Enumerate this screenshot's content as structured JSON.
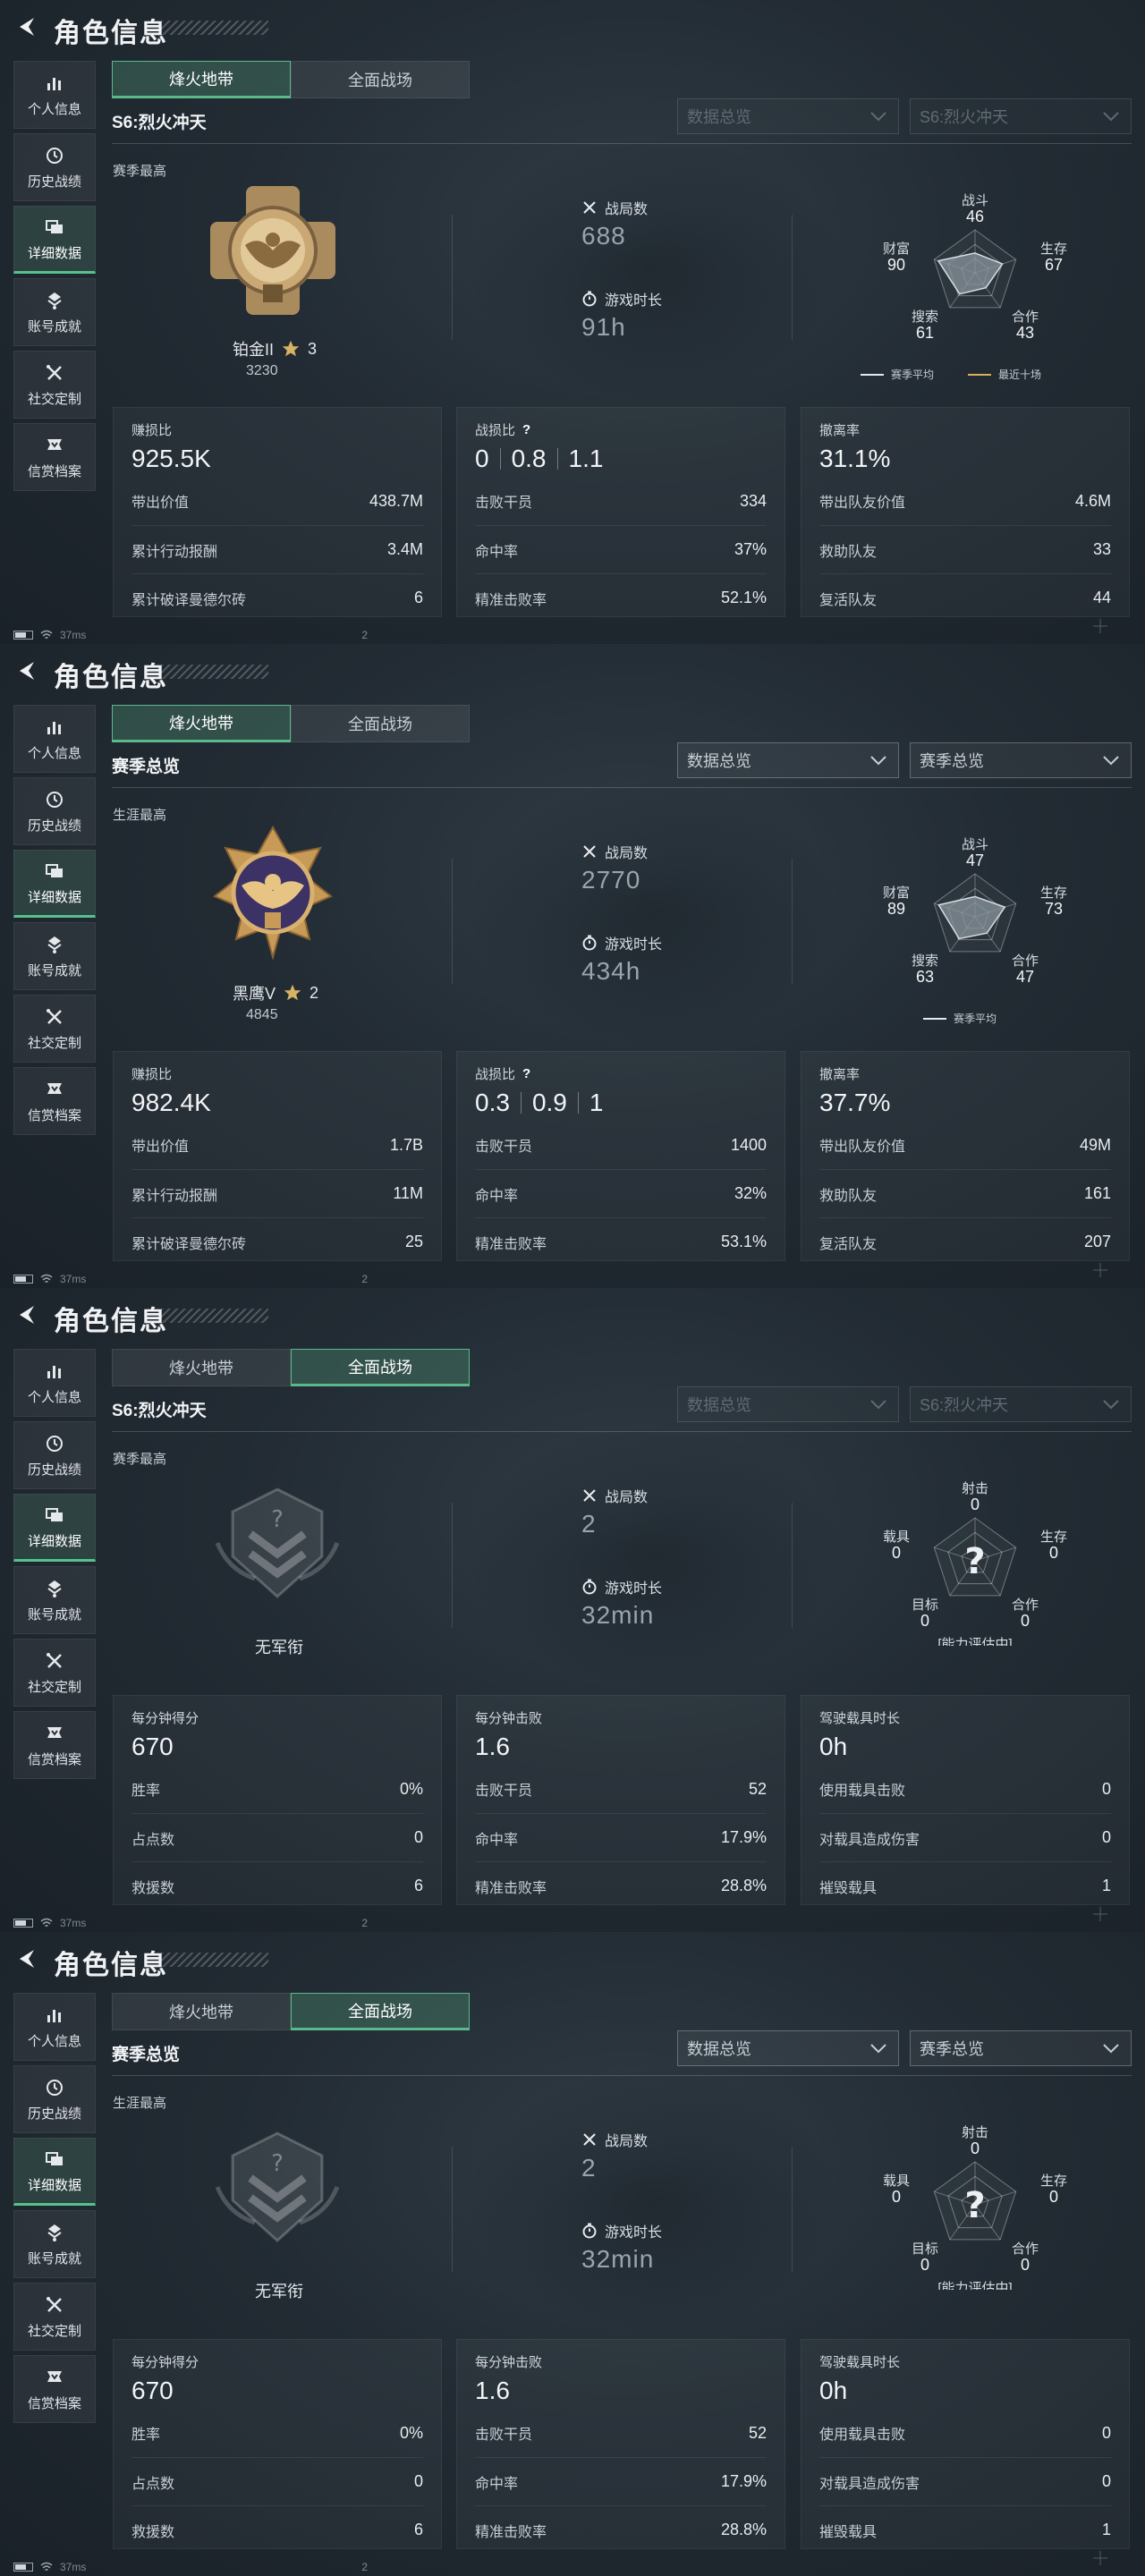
{
  "panels": [
    {
      "page_title": "角色信息",
      "sidebar": [
        "个人信息",
        "历史战绩",
        "详细数据",
        "账号成就",
        "社交定制",
        "信赏档案"
      ],
      "active_side": 2,
      "tabs": [
        "烽火地带",
        "全面战场"
      ],
      "active_tab": 0,
      "season_title": "S6:烈火冲天",
      "dropdowns": [
        "数据总览",
        "S6:烈火冲天"
      ],
      "dropdowns_dim": true,
      "section_label": "赛季最高",
      "rank": {
        "name": "铂金II",
        "stars": "3",
        "score": "3230",
        "badge": "gold"
      },
      "stats": {
        "matches_label": "战局数",
        "matches": "688",
        "time_label": "游戏时长",
        "time": "91h"
      },
      "radar": {
        "labels": [
          "战斗",
          "生存",
          "合作",
          "搜索",
          "财富"
        ],
        "values": [
          "46",
          "67",
          "43",
          "61",
          "90"
        ],
        "levels": [
          0.46,
          0.67,
          0.43,
          0.61,
          0.9
        ],
        "center_q": false,
        "legend": [
          "赛季平均",
          "最近十场"
        ]
      },
      "cards": [
        {
          "title": "赚损比",
          "big": [
            "925.5K"
          ],
          "rows": [
            [
              "带出价值",
              "438.7M"
            ],
            [
              "累计行动报酬",
              "3.4M"
            ],
            [
              "累计破译曼德尔砖",
              "6"
            ]
          ]
        },
        {
          "title": "战损比",
          "help": "?",
          "big": [
            "0",
            "0.8",
            "1.1"
          ],
          "rows": [
            [
              "击败干员",
              "334"
            ],
            [
              "命中率",
              "37%"
            ],
            [
              "精准击败率",
              "52.1%"
            ]
          ]
        },
        {
          "title": "撤离率",
          "big": [
            "31.1%"
          ],
          "rows": [
            [
              "带出队友价值",
              "4.6M"
            ],
            [
              "救助队友",
              "33"
            ],
            [
              "复活队友",
              "44"
            ]
          ]
        }
      ],
      "status": {
        "ping": "37ms",
        "extra": "2"
      }
    },
    {
      "page_title": "角色信息",
      "sidebar": [
        "个人信息",
        "历史战绩",
        "详细数据",
        "账号成就",
        "社交定制",
        "信赏档案"
      ],
      "active_side": 2,
      "tabs": [
        "烽火地带",
        "全面战场"
      ],
      "active_tab": 0,
      "season_title": "赛季总览",
      "dropdowns": [
        "数据总览",
        "赛季总览"
      ],
      "dropdowns_dim": false,
      "section_label": "生涯最高",
      "rank": {
        "name": "黑鹰V",
        "stars": "2",
        "score": "4845",
        "badge": "purple"
      },
      "stats": {
        "matches_label": "战局数",
        "matches": "2770",
        "time_label": "游戏时长",
        "time": "434h"
      },
      "radar": {
        "labels": [
          "战斗",
          "生存",
          "合作",
          "搜索",
          "财富"
        ],
        "values": [
          "47",
          "73",
          "47",
          "63",
          "89"
        ],
        "levels": [
          0.47,
          0.73,
          0.47,
          0.63,
          0.89
        ],
        "center_q": false,
        "legend": [
          "赛季平均"
        ]
      },
      "cards": [
        {
          "title": "赚损比",
          "big": [
            "982.4K"
          ],
          "rows": [
            [
              "带出价值",
              "1.7B"
            ],
            [
              "累计行动报酬",
              "11M"
            ],
            [
              "累计破译曼德尔砖",
              "25"
            ]
          ]
        },
        {
          "title": "战损比",
          "help": "?",
          "big": [
            "0.3",
            "0.9",
            "1"
          ],
          "rows": [
            [
              "击败干员",
              "1400"
            ],
            [
              "命中率",
              "32%"
            ],
            [
              "精准击败率",
              "53.1%"
            ]
          ]
        },
        {
          "title": "撤离率",
          "big": [
            "37.7%"
          ],
          "rows": [
            [
              "带出队友价值",
              "49M"
            ],
            [
              "救助队友",
              "161"
            ],
            [
              "复活队友",
              "207"
            ]
          ]
        }
      ],
      "status": {
        "ping": "37ms",
        "extra": "2"
      }
    },
    {
      "page_title": "角色信息",
      "sidebar": [
        "个人信息",
        "历史战绩",
        "详细数据",
        "账号成就",
        "社交定制",
        "信赏档案"
      ],
      "active_side": 2,
      "tabs": [
        "烽火地带",
        "全面战场"
      ],
      "active_tab": 1,
      "season_title": "S6:烈火冲天",
      "dropdowns": [
        "数据总览",
        "S6:烈火冲天"
      ],
      "dropdowns_dim": true,
      "section_label": "赛季最高",
      "rank": {
        "name": "无军衔",
        "badge": "none"
      },
      "stats": {
        "matches_label": "战局数",
        "matches": "2",
        "time_label": "游戏时长",
        "time": "32min"
      },
      "radar": {
        "labels": [
          "射击",
          "生存",
          "合作",
          "目标",
          "载具"
        ],
        "values": [
          "0",
          "0",
          "0",
          "0",
          "0"
        ],
        "levels": [
          0,
          0,
          0,
          0,
          0
        ],
        "center_q": true,
        "note": "[能力评估中]"
      },
      "cards": [
        {
          "title": "每分钟得分",
          "big": [
            "670"
          ],
          "rows": [
            [
              "胜率",
              "0%"
            ],
            [
              "占点数",
              "0"
            ],
            [
              "救援数",
              "6"
            ]
          ]
        },
        {
          "title": "每分钟击败",
          "big": [
            "1.6"
          ],
          "rows": [
            [
              "击败干员",
              "52"
            ],
            [
              "命中率",
              "17.9%"
            ],
            [
              "精准击败率",
              "28.8%"
            ]
          ]
        },
        {
          "title": "驾驶载具时长",
          "big": [
            "0h"
          ],
          "rows": [
            [
              "使用载具击败",
              "0"
            ],
            [
              "对载具造成伤害",
              "0"
            ],
            [
              "摧毁载具",
              "1"
            ]
          ]
        }
      ],
      "status": {
        "ping": "37ms",
        "extra": "2"
      }
    },
    {
      "page_title": "角色信息",
      "sidebar": [
        "个人信息",
        "历史战绩",
        "详细数据",
        "账号成就",
        "社交定制",
        "信赏档案"
      ],
      "active_side": 2,
      "tabs": [
        "烽火地带",
        "全面战场"
      ],
      "active_tab": 1,
      "season_title": "赛季总览",
      "dropdowns": [
        "数据总览",
        "赛季总览"
      ],
      "dropdowns_dim": false,
      "section_label": "生涯最高",
      "rank": {
        "name": "无军衔",
        "badge": "none"
      },
      "stats": {
        "matches_label": "战局数",
        "matches": "2",
        "time_label": "游戏时长",
        "time": "32min"
      },
      "radar": {
        "labels": [
          "射击",
          "生存",
          "合作",
          "目标",
          "载具"
        ],
        "values": [
          "0",
          "0",
          "0",
          "0",
          "0"
        ],
        "levels": [
          0,
          0,
          0,
          0,
          0
        ],
        "center_q": true,
        "note": "[能力评估中]"
      },
      "cards": [
        {
          "title": "每分钟得分",
          "big": [
            "670"
          ],
          "rows": [
            [
              "胜率",
              "0%"
            ],
            [
              "占点数",
              "0"
            ],
            [
              "救援数",
              "6"
            ]
          ]
        },
        {
          "title": "每分钟击败",
          "big": [
            "1.6"
          ],
          "rows": [
            [
              "击败干员",
              "52"
            ],
            [
              "命中率",
              "17.9%"
            ],
            [
              "精准击败率",
              "28.8%"
            ]
          ]
        },
        {
          "title": "驾驶载具时长",
          "big": [
            "0h"
          ],
          "rows": [
            [
              "使用载具击败",
              "0"
            ],
            [
              "对载具造成伤害",
              "0"
            ],
            [
              "摧毁载具",
              "1"
            ]
          ]
        }
      ],
      "status": {
        "ping": "37ms",
        "extra": "2"
      }
    }
  ],
  "colors": {
    "accent": "#55c28d",
    "radar_fill": "#8a949c",
    "legend_recent": "#d9b15a"
  }
}
